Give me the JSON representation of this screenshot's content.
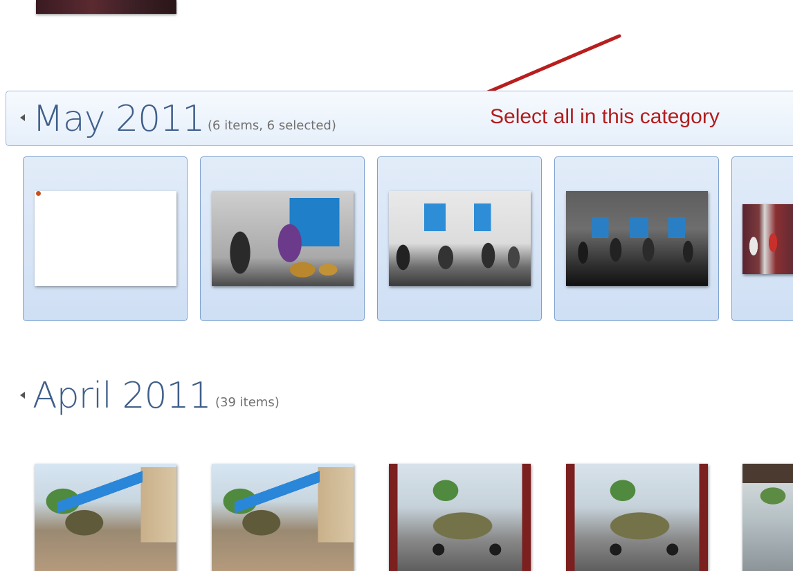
{
  "groups": [
    {
      "title": "May 2011",
      "count": "(6 items, 6 selected)",
      "selected": true
    },
    {
      "title": "April 2011",
      "count": "(39 items)",
      "selected": false
    }
  ],
  "annotation": {
    "text": "Select all in this category",
    "color": "#b21d1d"
  },
  "colors": {
    "header_title": "#3f5f8a",
    "selection_border": "#7da2ce",
    "selection_fill": "#dbe7f7"
  }
}
